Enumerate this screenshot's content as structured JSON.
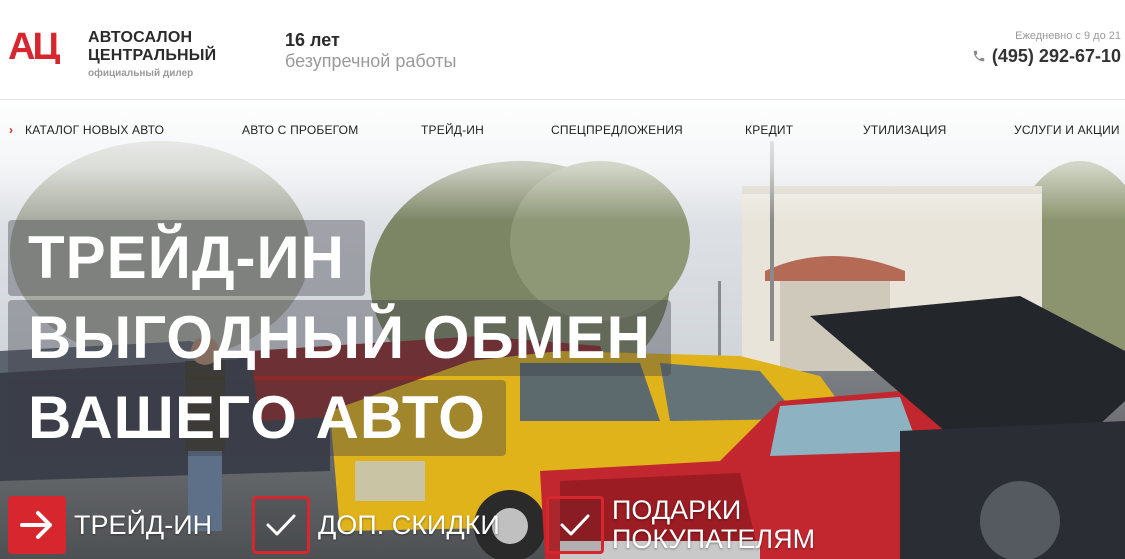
{
  "header": {
    "brand_line1": "АВТОСАЛОН",
    "brand_line2": "ЦЕНТРАЛЬНЫЙ",
    "brand_sub": "официальный дилер",
    "logo_text": "АЦ",
    "years_num": "16 лет",
    "years_text": "безупречной работы",
    "hours": "Ежедневно с 9 до 21",
    "phone": "(495) 292-67-10"
  },
  "nav": {
    "items": [
      {
        "label": "КАТАЛОГ НОВЫХ АВТО"
      },
      {
        "label": "АВТО С ПРОБЕГОМ"
      },
      {
        "label": "ТРЕЙД-ИН"
      },
      {
        "label": "СПЕЦПРЕДЛОЖЕНИЯ"
      },
      {
        "label": "КРЕДИТ"
      },
      {
        "label": "УТИЛИЗАЦИЯ"
      },
      {
        "label": "УСЛУГИ И АКЦИИ"
      }
    ]
  },
  "hero": {
    "line1": "ТРЕЙД-ИН",
    "line2": "ВЫГОДНЫЙ ОБМЕН",
    "line3": "ВАШЕГО АВТО",
    "features": [
      {
        "label": "ТРЕЙД-ИН",
        "icon": "arrow-right-icon"
      },
      {
        "label": "ДОП. СКИДКИ",
        "icon": "checkmark-icon"
      },
      {
        "label_line1": "ПОДАРКИ",
        "label_line2": "ПОКУПАТЕЛЯМ",
        "icon": "checkmark-icon"
      }
    ]
  },
  "colors": {
    "accent": "#d8262e",
    "text_dark": "#2b2b2b",
    "text_muted": "#9a9a9a"
  }
}
